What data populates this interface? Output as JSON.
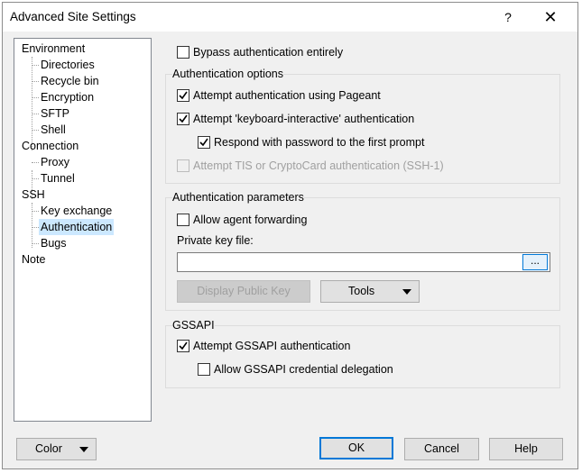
{
  "window": {
    "title": "Advanced Site Settings",
    "help_label": "?",
    "close_label": "✕"
  },
  "tree": {
    "items": [
      {
        "label": "Environment"
      },
      {
        "label": "Directories"
      },
      {
        "label": "Recycle bin"
      },
      {
        "label": "Encryption"
      },
      {
        "label": "SFTP"
      },
      {
        "label": "Shell"
      },
      {
        "label": "Connection"
      },
      {
        "label": "Proxy"
      },
      {
        "label": "Tunnel"
      },
      {
        "label": "SSH"
      },
      {
        "label": "Key exchange"
      },
      {
        "label": "Authentication",
        "selected": true
      },
      {
        "label": "Bugs"
      },
      {
        "label": "Note"
      }
    ]
  },
  "bypass": {
    "label": "Bypass authentication entirely",
    "checked": false
  },
  "auth_options": {
    "title": "Authentication options",
    "pageant": {
      "label": "Attempt authentication using Pageant",
      "checked": true
    },
    "keyboard": {
      "label": "Attempt 'keyboard-interactive' authentication",
      "checked": true
    },
    "respond": {
      "label": "Respond with password to the first prompt",
      "checked": true
    },
    "tis": {
      "label": "Attempt TIS or CryptoCard authentication (SSH-1)",
      "checked": false,
      "disabled": true
    }
  },
  "auth_params": {
    "title": "Authentication parameters",
    "agent_forwarding": {
      "label": "Allow agent forwarding",
      "checked": false
    },
    "private_key_label": "Private key file:",
    "private_key_value": "",
    "browse_label": "...",
    "display_public_key_label": "Display Public Key",
    "tools_label": "Tools"
  },
  "gssapi": {
    "title": "GSSAPI",
    "attempt": {
      "label": "Attempt GSSAPI authentication",
      "checked": true
    },
    "delegation": {
      "label": "Allow GSSAPI credential delegation",
      "checked": false
    }
  },
  "footer": {
    "color_label": "Color",
    "ok_label": "OK",
    "cancel_label": "Cancel",
    "help_label": "Help"
  }
}
